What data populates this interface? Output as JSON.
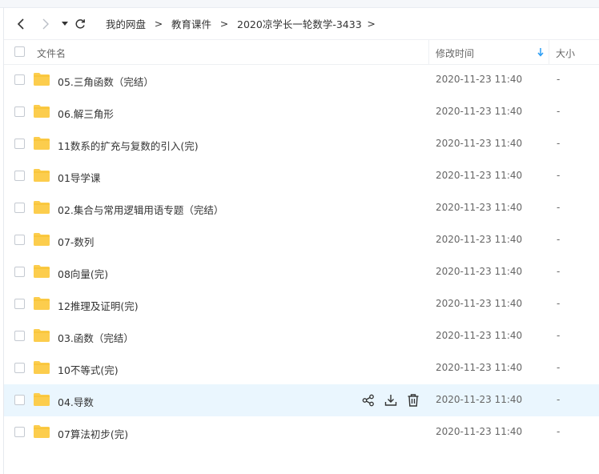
{
  "nav": {
    "breadcrumb": [
      "我的网盘",
      "教育课件",
      "2020凉学长一轮数学-3433"
    ],
    "separator": ">"
  },
  "header": {
    "name": "文件名",
    "modified": "修改时间",
    "size": "大小"
  },
  "colors": {
    "folder": "#fccd4d",
    "folder_dark": "#f5b81f",
    "hover_row": "#eaf6fe",
    "sort_arrow": "#2b9df4"
  },
  "files": [
    {
      "name": "05.三角函数（完结）",
      "modified": "2020-11-23 11:40",
      "size": "-"
    },
    {
      "name": "06.解三角形",
      "modified": "2020-11-23 11:40",
      "size": "-"
    },
    {
      "name": "11数系的扩充与复数的引入(完)",
      "modified": "2020-11-23 11:40",
      "size": "-"
    },
    {
      "name": "01导学课",
      "modified": "2020-11-23 11:40",
      "size": "-"
    },
    {
      "name": "02.集合与常用逻辑用语专题（完结）",
      "modified": "2020-11-23 11:40",
      "size": "-"
    },
    {
      "name": "07-数列",
      "modified": "2020-11-23 11:40",
      "size": "-"
    },
    {
      "name": "08向量(完)",
      "modified": "2020-11-23 11:40",
      "size": "-"
    },
    {
      "name": "12推理及证明(完)",
      "modified": "2020-11-23 11:40",
      "size": "-"
    },
    {
      "name": "03.函数（完结）",
      "modified": "2020-11-23 11:40",
      "size": "-"
    },
    {
      "name": "10不等式(完)",
      "modified": "2020-11-23 11:40",
      "size": "-"
    },
    {
      "name": "04.导数",
      "modified": "2020-11-23 11:40",
      "size": "-"
    },
    {
      "name": "07算法初步(完)",
      "modified": "2020-11-23 11:40",
      "size": "-"
    }
  ]
}
